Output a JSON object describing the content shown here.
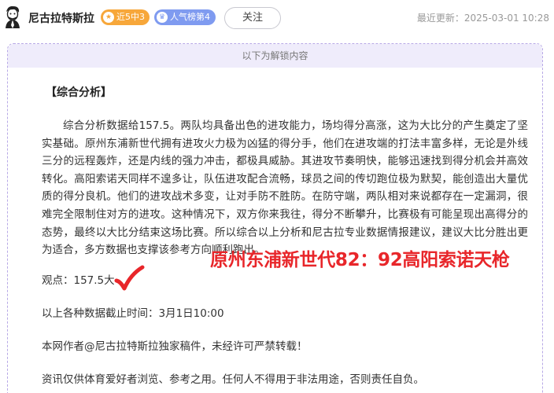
{
  "header": {
    "author_name": "尼古拉特斯拉",
    "avatar": "avatar-illustration",
    "badges": [
      {
        "label": "近5中3",
        "icon": "star-icon",
        "color": "#f7a73a"
      },
      {
        "label": "人气榜第4",
        "icon": "crown-icon",
        "color": "#7f9bf0"
      }
    ],
    "follow_label": "关注",
    "updated_label": "最近更新：2025-03-01 10:28"
  },
  "unlock": {
    "label": "以下为解锁内容"
  },
  "article": {
    "section_title": "【综合分析】",
    "paragraph": "综合分析数据给157.5。两队均具备出色的进攻能力，场均得分高涨，这为大比分的产生奠定了坚实基础。原州东浦新世代拥有进攻火力极为凶猛的得分手，他们在进攻端的打法丰富多样，无论是外线三分的远程轰炸，还是内线的强力冲击，都极具威胁。其进攻节奏明快，能够迅速找到得分机会并高效转化。高阳索诺天同样不遑多让，队伍进攻配合流畅，球员之间的传切跑位极为默契，能创造出大量优质的得分良机。他们的进攻战术多变，让对手防不胜防。在防守端，两队相对来说都存在一定漏洞，很难完全限制住对方的进攻。这种情况下，双方你来我往，得分不断攀升，比赛极有可能呈现出高得分的态势，最终以大比分结束这场比赛。所以综合以上分析和尼古拉专业数据情报建议，建议大比分胜出更为适合，多方数据也支撑该参考方向顺利跑出。",
    "overlay_score": "原州东浦新世代82：92高阳索诺天枪",
    "viewpoint": "观点：157.5大",
    "check_icon": "red-checkmark-icon",
    "data_cutoff": "以上各种数据截止时间：3月1日10:00",
    "copyright": "本网作者@尼古拉特斯拉独家稿件，未经许可严禁转载！",
    "disclaimer": "资讯仅供体育爱好者浏览、参考之用。任何人不得用于非法用途，否则责任自负。"
  },
  "colors": {
    "accent_purple": "#b7a8e6",
    "unlock_bg": "#efecfb",
    "score_red": "#e8262a"
  }
}
